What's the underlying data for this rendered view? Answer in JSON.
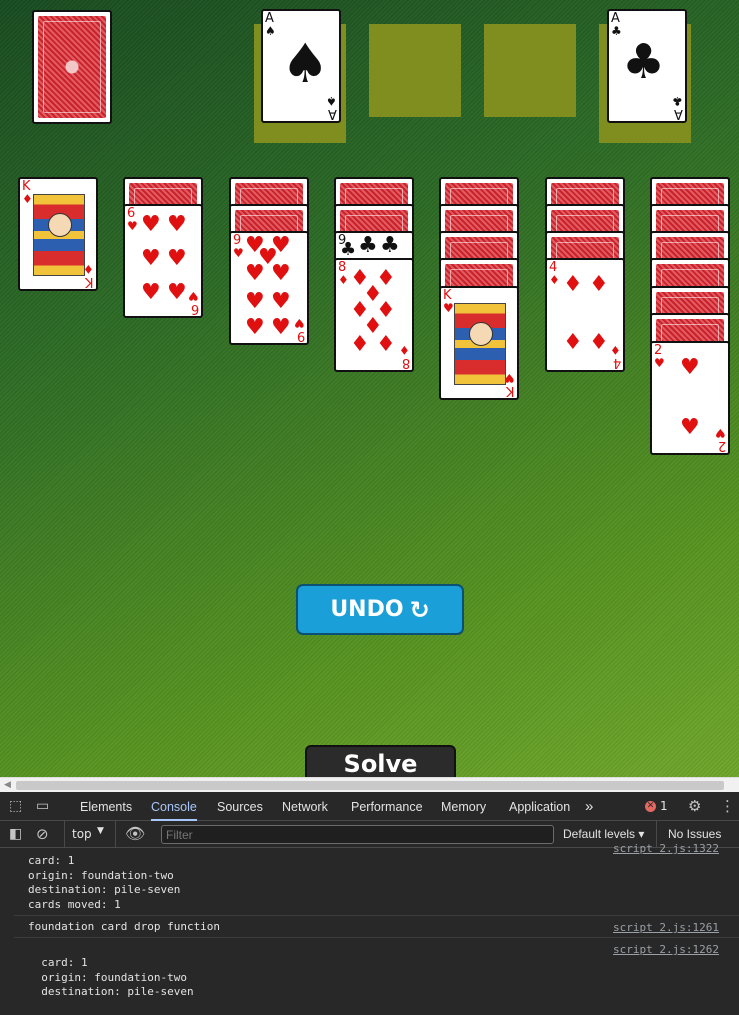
{
  "game": {
    "stock": {
      "face": "back"
    },
    "foundations": [
      {
        "card": {
          "rank": "A",
          "suit": "♠",
          "color": "black"
        }
      },
      {
        "card": null
      },
      {
        "card": null
      },
      {
        "card": {
          "rank": "A",
          "suit": "♣",
          "color": "black"
        }
      }
    ],
    "piles": [
      {
        "hidden": 0,
        "cards": [
          {
            "rank": "K",
            "suit": "♦",
            "color": "red"
          }
        ]
      },
      {
        "hidden": 1,
        "cards": [
          {
            "rank": "6",
            "suit": "♥",
            "color": "red"
          }
        ]
      },
      {
        "hidden": 2,
        "cards": [
          {
            "rank": "9",
            "suit": "♥",
            "color": "red"
          }
        ]
      },
      {
        "hidden": 2,
        "cards": [
          {
            "rank": "9",
            "suit": "♣",
            "color": "black"
          },
          {
            "rank": "8",
            "suit": "♦",
            "color": "red"
          }
        ]
      },
      {
        "hidden": 4,
        "cards": [
          {
            "rank": "K",
            "suit": "♥",
            "color": "red"
          }
        ]
      },
      {
        "hidden": 3,
        "cards": [
          {
            "rank": "4",
            "suit": "♦",
            "color": "red"
          }
        ]
      },
      {
        "hidden": 6,
        "cards": [
          {
            "rank": "2",
            "suit": "♥",
            "color": "red"
          }
        ]
      }
    ],
    "undo_label": "UNDO",
    "undo_icon": "↻",
    "solve_label": "Solve"
  },
  "devtools": {
    "tabs": [
      "Elements",
      "Console",
      "Sources",
      "Network",
      "Performance",
      "Memory",
      "Application"
    ],
    "active_tab": "Console",
    "more_tabs": "»",
    "error_count": "1",
    "context": "top",
    "filter_placeholder": "Filter",
    "levels_label": "Default levels ▾",
    "issues_label": "No Issues",
    "logs": [
      {
        "text": "card: 1\norigin: foundation-two\ndestination: pile-seven\ncards moved: 1",
        "source": "script 2.js:1322"
      },
      {
        "text": "foundation card drop function",
        "source": "script 2.js:1261"
      },
      {
        "text": "  card: 1\n  origin: foundation-two\n  destination: pile-seven",
        "source": "script 2.js:1262"
      }
    ]
  }
}
